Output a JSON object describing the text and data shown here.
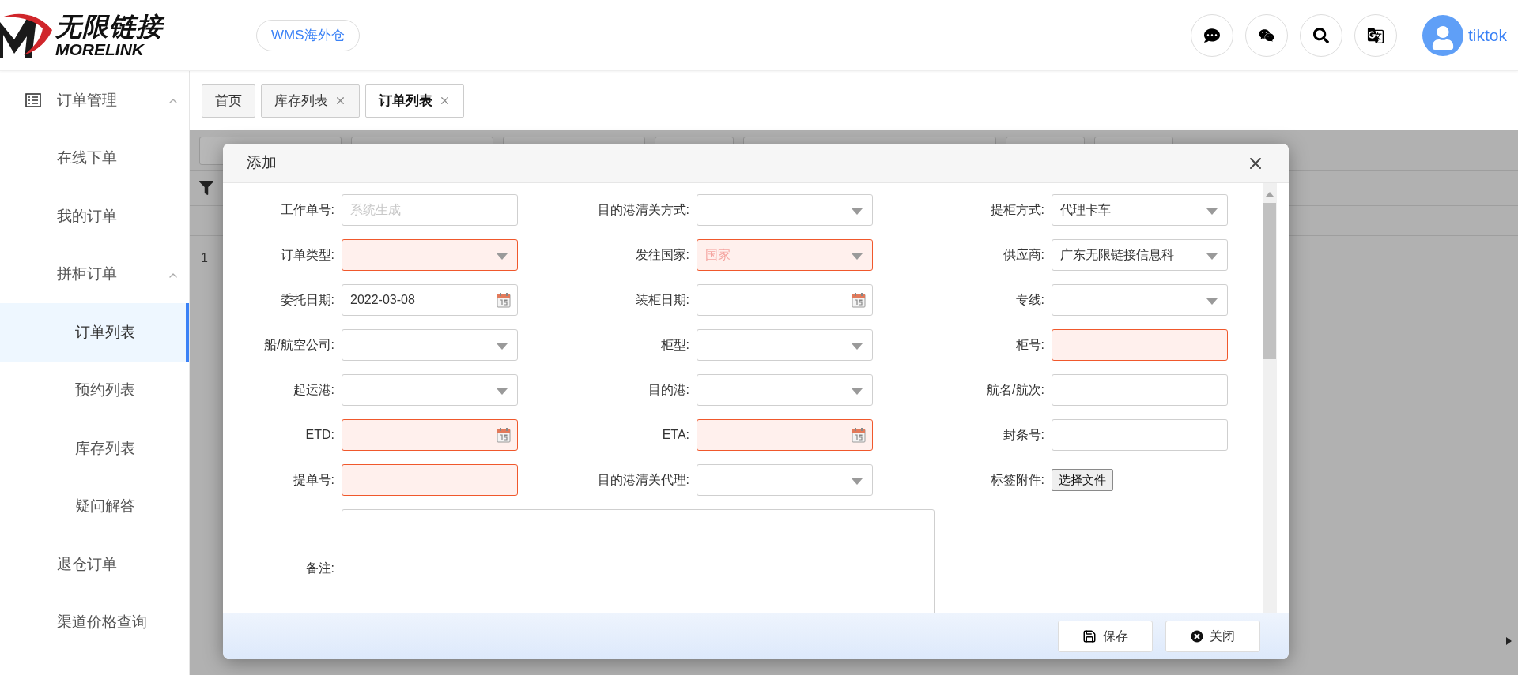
{
  "header": {
    "logo": {
      "title": "无限链接",
      "subtitle": "MORELINK"
    },
    "system_button": "WMS海外仓",
    "user": "tiktok"
  },
  "sidebar": {
    "items": [
      {
        "label": "订单管理",
        "expanded": true,
        "children": [
          {
            "label": "在线下单",
            "selected": false
          },
          {
            "label": "我的订单",
            "selected": false
          },
          {
            "label": "拼柜订单",
            "expanded": true,
            "children": [
              {
                "label": "订单列表",
                "selected": true
              },
              {
                "label": "预约列表",
                "selected": false
              },
              {
                "label": "库存列表",
                "selected": false
              },
              {
                "label": "疑问解答",
                "selected": false
              }
            ]
          },
          {
            "label": "退仓订单",
            "selected": false
          },
          {
            "label": "渠道价格查询",
            "selected": false
          }
        ]
      }
    ]
  },
  "tabs": [
    {
      "label": "首页",
      "closable": false,
      "selected": false
    },
    {
      "label": "库存列表",
      "closable": true,
      "selected": false
    },
    {
      "label": "订单列表",
      "closable": true,
      "selected": true
    }
  ],
  "background_table": {
    "row_number": "1"
  },
  "dialog": {
    "title": "添加",
    "rows": [
      [
        {
          "label": "工作单号:",
          "kind": "text",
          "placeholder": "系统生成",
          "invalid": false
        },
        {
          "label": "目的港清关方式:",
          "kind": "select",
          "invalid": false
        },
        {
          "label": "提柜方式:",
          "kind": "select",
          "value": "代理卡车",
          "invalid": false
        }
      ],
      [
        {
          "label": "订单类型:",
          "kind": "select",
          "invalid": true
        },
        {
          "label": "发往国家:",
          "kind": "select",
          "placeholder": "国家",
          "invalid": true
        },
        {
          "label": "供应商:",
          "kind": "select",
          "value": "广东无限链接信息科",
          "invalid": false
        }
      ],
      [
        {
          "label": "委托日期:",
          "kind": "date",
          "value": "2022-03-08",
          "invalid": false
        },
        {
          "label": "装柜日期:",
          "kind": "date",
          "invalid": false
        },
        {
          "label": "专线:",
          "kind": "select",
          "invalid": false
        }
      ],
      [
        {
          "label": "船/航空公司:",
          "kind": "select",
          "invalid": false
        },
        {
          "label": "柜型:",
          "kind": "select",
          "invalid": false
        },
        {
          "label": "柜号:",
          "kind": "text",
          "invalid": true
        }
      ],
      [
        {
          "label": "起运港:",
          "kind": "select",
          "invalid": false
        },
        {
          "label": "目的港:",
          "kind": "select",
          "invalid": false
        },
        {
          "label": "航名/航次:",
          "kind": "text",
          "invalid": false
        }
      ],
      [
        {
          "label": "ETD:",
          "kind": "date",
          "invalid": true
        },
        {
          "label": "ETA:",
          "kind": "date",
          "invalid": true
        },
        {
          "label": "封条号:",
          "kind": "text",
          "invalid": false
        }
      ],
      [
        {
          "label": "提单号:",
          "kind": "text",
          "invalid": true
        },
        {
          "label": "目的港清关代理:",
          "kind": "select",
          "invalid": false
        },
        {
          "label": "标签附件:",
          "kind": "file",
          "button": "选择文件"
        }
      ]
    ],
    "remarks": {
      "label": "备注:"
    },
    "buttons": [
      {
        "label": "保存",
        "kind": "save"
      },
      {
        "label": "关闭",
        "kind": "close"
      }
    ]
  }
}
